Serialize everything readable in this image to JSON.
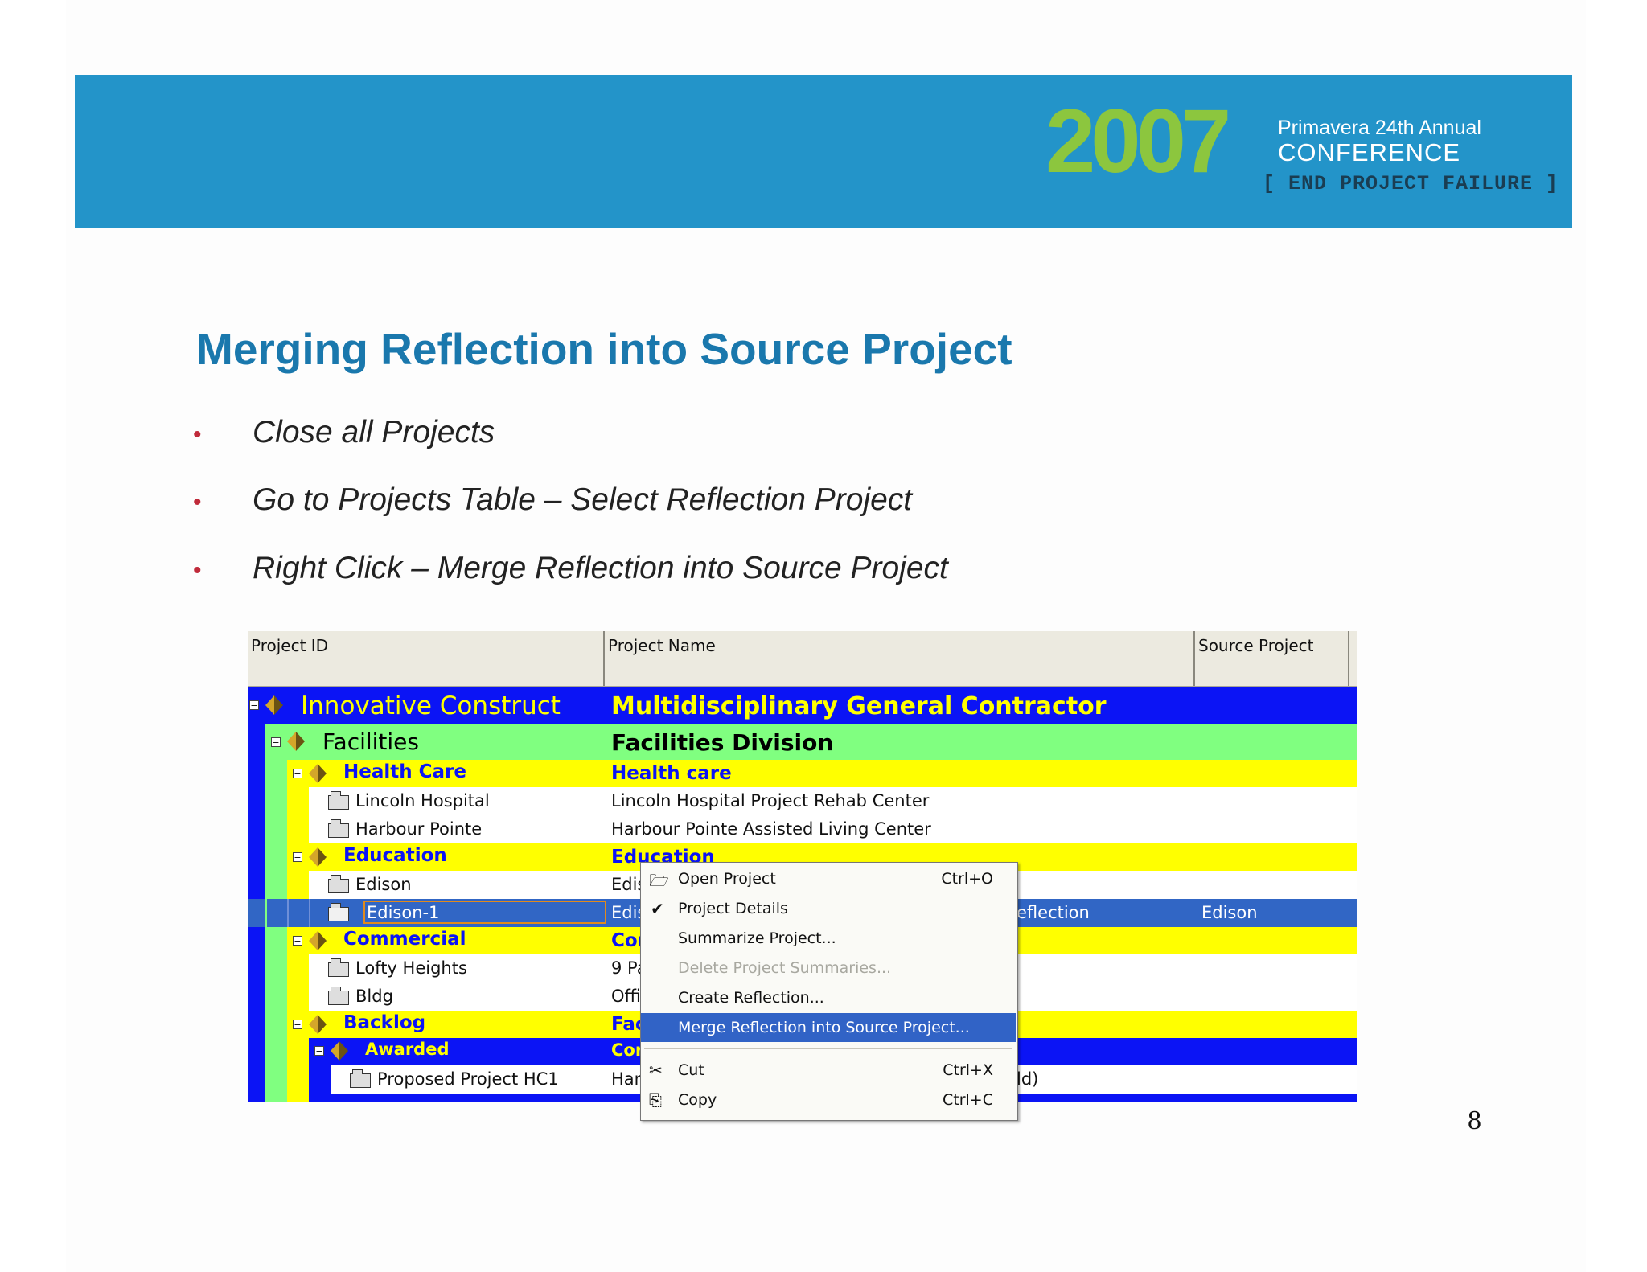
{
  "banner": {
    "year": "2007",
    "line1": "Primavera 24th Annual",
    "line2": "CONFERENCE",
    "line3": "[ END PROJECT FAILURE ]"
  },
  "slide": {
    "title": "Merging Reflection into Source Project",
    "bullets": [
      "Close all Projects",
      "Go to Projects Table – Select Reflection Project",
      "Right Click – Merge Reflection into Source Project"
    ],
    "page_number": "8"
  },
  "table": {
    "headers": [
      "Project ID",
      "Project Name",
      "Source Project"
    ],
    "rows": [
      {
        "id": "Innovative Construct",
        "name": "Multidisciplinary General Contractor",
        "src": ""
      },
      {
        "id": "Facilities",
        "name": "Facilities Division",
        "src": ""
      },
      {
        "id": "Health Care",
        "name": "Health care",
        "src": ""
      },
      {
        "id": "Lincoln Hospital",
        "name": "Lincoln Hospital Project Rehab Center",
        "src": ""
      },
      {
        "id": "Harbour Pointe",
        "name": "Harbour Pointe Assisted Living Center",
        "src": ""
      },
      {
        "id": "Education",
        "name": "Education",
        "src": ""
      },
      {
        "id": "Edison",
        "name": "Edis",
        "src": ""
      },
      {
        "id": "Edison-1",
        "name": "Edis",
        "mid": "eflection",
        "src": "Edison"
      },
      {
        "id": "Commercial",
        "name": "Cor",
        "src": ""
      },
      {
        "id": "Lofty Heights",
        "name": "9 Pa",
        "src": ""
      },
      {
        "id": "Bldg",
        "name": "Offic",
        "src": ""
      },
      {
        "id": "Backlog",
        "name": "Fac",
        "src": ""
      },
      {
        "id": "Awarded",
        "name": "Cor",
        "src": ""
      },
      {
        "id": "Proposed Project HC1",
        "name": "Han",
        "mid": "ld)",
        "src": ""
      }
    ]
  },
  "context_menu": {
    "items": [
      {
        "label": "Open Project",
        "shortcut": "Ctrl+O"
      },
      {
        "label": "Project Details",
        "shortcut": ""
      },
      {
        "label": "Summarize Project...",
        "shortcut": ""
      },
      {
        "label": "Delete Project Summaries...",
        "shortcut": ""
      },
      {
        "label": "Create Reflection...",
        "shortcut": ""
      },
      {
        "label": "Merge Reflection into Source Project...",
        "shortcut": ""
      },
      {
        "label": "Cut",
        "shortcut": "Ctrl+X"
      },
      {
        "label": "Copy",
        "shortcut": "Ctrl+C"
      }
    ],
    "highlighted": "Merge Reflection into Source Project..."
  },
  "colors": {
    "banner": "#2394c9",
    "logo_green": "#8cc63e",
    "title": "#1a78ad",
    "bullet_dot": "#c02a3a",
    "level_blue": "#0b14f5",
    "level_green": "#80ff80",
    "level_yellow": "#ffff00",
    "selection": "#3166c5"
  }
}
